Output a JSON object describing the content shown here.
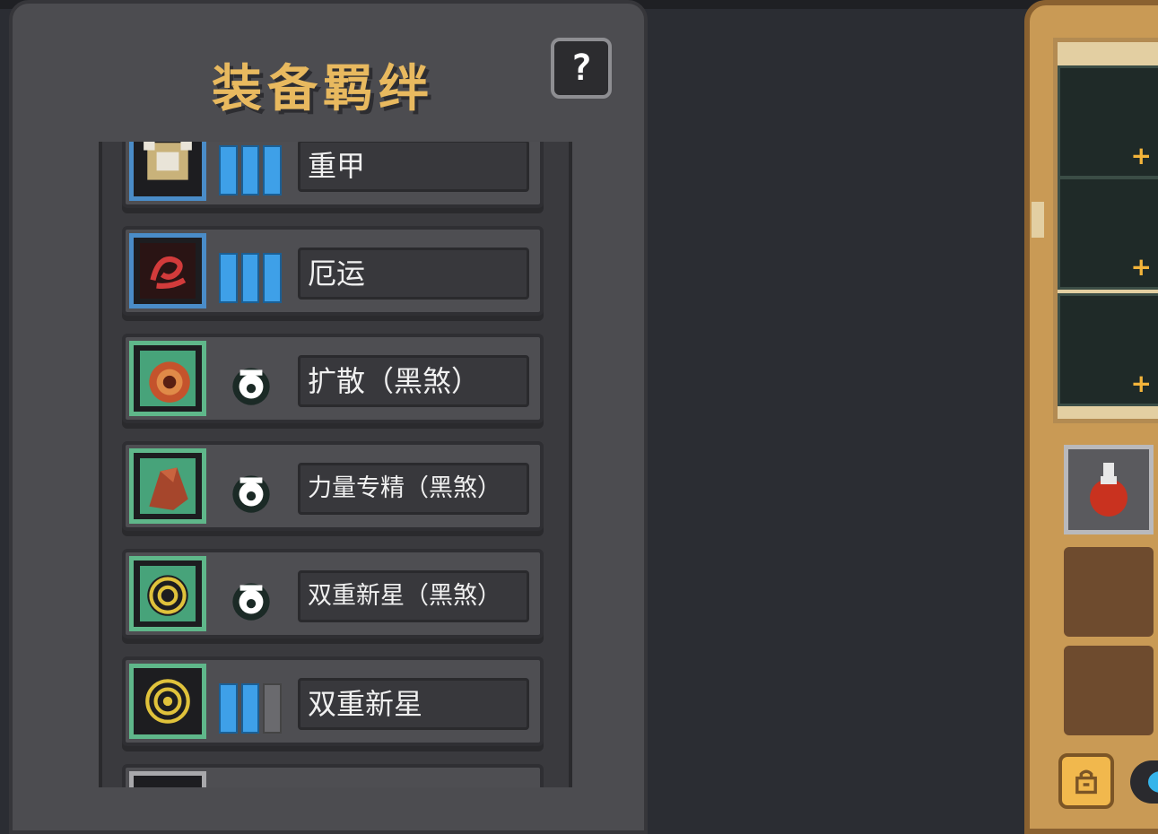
{
  "panel": {
    "title": "装备羁绊",
    "help_label": "?"
  },
  "rows": [
    {
      "name": "重甲",
      "icon": "armor-icon",
      "badge": "meter",
      "level": 3,
      "max": 3
    },
    {
      "name": "厄运",
      "icon": "doom-icon",
      "badge": "meter",
      "level": 3,
      "max": 3
    },
    {
      "name": "扩散（黑煞）",
      "icon": "spread-icon",
      "badge": "demon"
    },
    {
      "name": "力量专精（黑煞）",
      "icon": "power-icon",
      "badge": "demon"
    },
    {
      "name": "双重新星（黑煞）",
      "icon": "nova-icon",
      "badge": "demon"
    },
    {
      "name": "双重新星",
      "icon": "nova-icon",
      "badge": "meter",
      "level": 2,
      "max": 3
    }
  ],
  "colors": {
    "title": "#e8b95f",
    "meter_fill": "#3ea0e8",
    "border_blue": "#4a8cc8",
    "border_green": "#5fb78a"
  }
}
